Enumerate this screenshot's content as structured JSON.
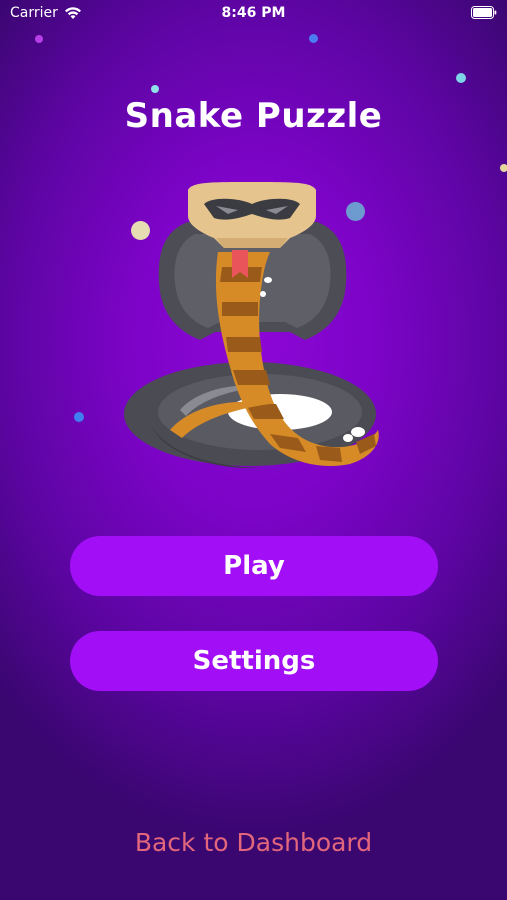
{
  "status_bar": {
    "carrier": "Carrier",
    "time": "8:46 PM",
    "wifi_icon": "wifi-icon",
    "battery_icon": "battery-icon"
  },
  "title": "Snake Puzzle",
  "illustration_icon": "cobra-illustration",
  "buttons": {
    "play": "Play",
    "settings": "Settings"
  },
  "back_link": "Back to Dashboard",
  "colors": {
    "background": "#7c04c7",
    "button": "#a20ef5",
    "back_link": "#e2677d"
  }
}
